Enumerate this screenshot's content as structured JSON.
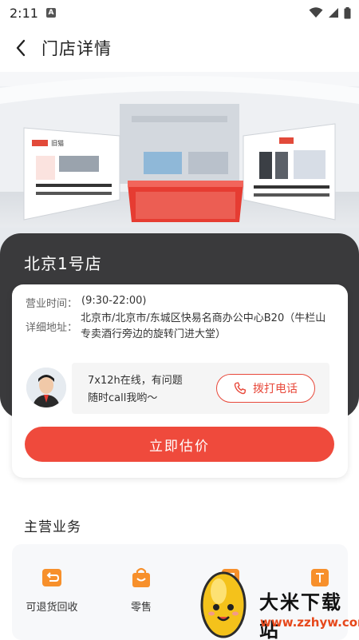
{
  "status_bar": {
    "time": "2:11",
    "notification_badge": "A"
  },
  "nav": {
    "title": "门店详情"
  },
  "hero": {
    "brand_mark": "旧猫"
  },
  "store": {
    "name": "北京1号店",
    "hours_label": "营业时间：",
    "hours_value": "(9:30-22:00)",
    "address_label": "详细地址：",
    "address_value": "北京市/北京市/东城区快易名商办公中心B20（牛栏山专卖酒行旁边的旋转门进大堂）"
  },
  "contact": {
    "line1": "7x12h在线，有问题",
    "line2": "随时call我哟～",
    "call_label": "拨打电话"
  },
  "actions": {
    "estimate_label": "立即估价"
  },
  "business": {
    "title": "主营业务",
    "items": [
      {
        "label": "可退货回收",
        "icon": "return-icon"
      },
      {
        "label": "零售",
        "icon": "shopping-bag-icon"
      },
      {
        "label": "",
        "icon": "trade-icon"
      },
      {
        "label": "",
        "icon": "price-icon"
      }
    ]
  },
  "watermark": {
    "name": "大米下载站",
    "url": "www.zzhyw.com"
  },
  "colors": {
    "accent": "#ef4a3c",
    "icon_orange": "#f7902b",
    "dark_panel": "#3a3a3c"
  }
}
